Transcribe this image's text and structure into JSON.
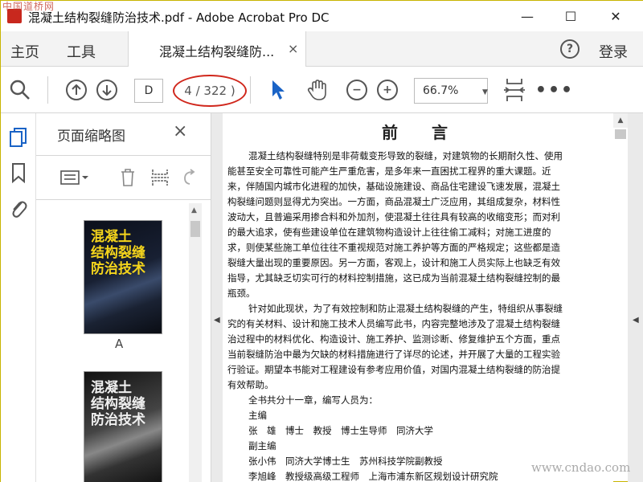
{
  "window": {
    "title": "混凝土结构裂缝防治技术.pdf - Adobe Acrobat Pro DC",
    "watermark_top": "中国道桥网",
    "minimize": "—",
    "maximize": "☐",
    "close": "✕"
  },
  "tabs": {
    "home": "主页",
    "tools": "工具",
    "document": "混凝土结构裂缝防...",
    "document_close": "×",
    "help": "?",
    "login": "登录"
  },
  "toolbar": {
    "page_input": "D",
    "page_count": "4 / 322 )",
    "zoom": "66.7%",
    "icons": [
      "search-icon",
      "previous-page-icon",
      "next-page-icon",
      "select-cursor-icon",
      "hand-tool-icon",
      "zoom-out-icon",
      "zoom-in-icon",
      "fit-page-icon",
      "more-icon"
    ]
  },
  "sidebar": {
    "panel_title": "页面缩略图",
    "panel_close": "×",
    "thumbnails": [
      {
        "title_line1": "混凝土",
        "title_line2": "结构裂缝",
        "title_line3": "防治技术",
        "label": "A"
      },
      {
        "title_line1": "混凝土",
        "title_line2": "结构裂缝",
        "title_line3": "防治技术",
        "label": ""
      }
    ]
  },
  "document": {
    "heading": "前言",
    "lines": [
      {
        "text": "混凝土结构裂缝特别是非荷载变形导致的裂缝，对建筑物的长期耐久性、使用",
        "indent": true,
        "bold": false
      },
      {
        "text": "能甚至安全可靠性可能产生严重危害，是多年来一直困扰工程界的重大课题。近",
        "indent": false,
        "bold": false
      },
      {
        "text": "来，伴随国内城市化进程的加快，基础设施建设、商品住宅建设飞速发展，混凝土",
        "indent": false,
        "bold": false
      },
      {
        "text": "构裂缝问题则显得尤为突出。一方面，商品混凝土广泛应用，其组成复杂，材料性",
        "indent": false,
        "bold": false
      },
      {
        "text": "波动大，且普遍采用掺合料和外加剂，使混凝土往往具有较高的收缩变形；而对利",
        "indent": false,
        "bold": false
      },
      {
        "text": "的最大追求，使有些建设单位在建筑物构造设计上往往偷工减料；对施工进度的",
        "indent": false,
        "bold": false
      },
      {
        "text": "求，则使某些施工单位往往不重视规范对施工养护等方面的严格规定；这些都是造",
        "indent": false,
        "bold": false
      },
      {
        "text": "裂缝大量出现的重要原因。另一方面，客观上，设计和施工人员实际上也缺乏有效",
        "indent": false,
        "bold": false
      },
      {
        "text": "指导，尤其缺乏切实可行的材料控制措施，这已成为当前混凝土结构裂缝控制的最",
        "indent": false,
        "bold": false
      },
      {
        "text": "瓶颈。",
        "indent": false,
        "bold": false
      },
      {
        "text": "针对如此现状，为了有效控制和防止混凝土结构裂缝的产生，特组织从事裂缝",
        "indent": true,
        "bold": false
      },
      {
        "text": "究的有关材料、设计和施工技术人员编写此书，内容完整地涉及了混凝土结构裂缝",
        "indent": false,
        "bold": false
      },
      {
        "text": "治过程中的材料优化、构造设计、施工养护、监测诊断、修复维护五个方面，重点",
        "indent": false,
        "bold": false
      },
      {
        "text": "当前裂缝防治中最为欠缺的材料措施进行了详尽的论述，并开展了大量的工程实验",
        "indent": false,
        "bold": false
      },
      {
        "text": "行验证。期望本书能对工程建设有参考应用价值，对国内混凝土结构裂缝的防治提",
        "indent": false,
        "bold": false
      },
      {
        "text": "有效帮助。",
        "indent": false,
        "bold": false
      },
      {
        "text": "全书共分十一章，编写人员为：",
        "indent": true,
        "bold": false
      },
      {
        "text": "主编",
        "indent": true,
        "bold": false
      },
      {
        "text": "张　雄　博士　教授　博士生导师　同济大学",
        "indent": true,
        "bold": false
      },
      {
        "text": "副主编",
        "indent": true,
        "bold": false
      },
      {
        "text": "张小伟　同济大学博士生　苏州科技学院副教授",
        "indent": true,
        "bold": false
      },
      {
        "text": "李旭峰　教授级高级工程师　上海市浦东新区规划设计研究院",
        "indent": true,
        "bold": false
      }
    ]
  },
  "watermark_bottom": "www.cndao.com"
}
